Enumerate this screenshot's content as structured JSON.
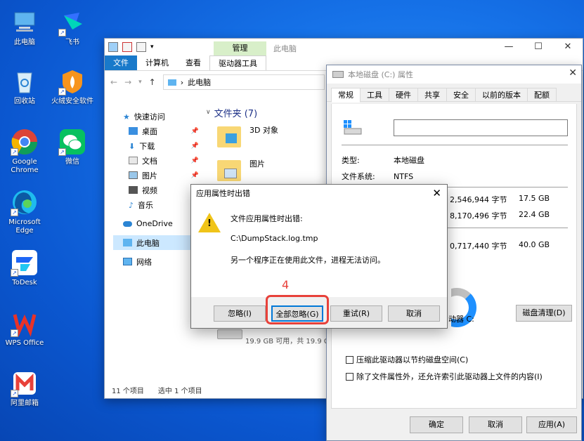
{
  "desktop": {
    "icons": [
      {
        "label": "此电脑",
        "icon": "this-pc-icon"
      },
      {
        "label": "飞书",
        "icon": "feishu-icon"
      },
      {
        "label": "回收站",
        "icon": "recycle-bin-icon"
      },
      {
        "label": "火绒安全软件",
        "icon": "huorong-icon"
      },
      {
        "label": "Google Chrome",
        "icon": "chrome-icon"
      },
      {
        "label": "微信",
        "icon": "wechat-icon"
      },
      {
        "label": "Microsoft Edge",
        "icon": "edge-icon"
      },
      {
        "label": "ToDesk",
        "icon": "todesk-icon"
      },
      {
        "label": "WPS Office",
        "icon": "wps-icon"
      },
      {
        "label": "阿里邮箱",
        "icon": "ali-mail-icon"
      }
    ]
  },
  "explorer": {
    "title_tab": "管理",
    "title": "此电脑",
    "ribbon_tabs": [
      "文件",
      "计算机",
      "查看",
      "驱动器工具"
    ],
    "address": "此电脑",
    "nav": [
      {
        "label": "快速访问"
      },
      {
        "label": "桌面"
      },
      {
        "label": "下载"
      },
      {
        "label": "文档"
      },
      {
        "label": "图片"
      },
      {
        "label": "视频"
      },
      {
        "label": "音乐"
      },
      {
        "label": "OneDrive"
      },
      {
        "label": "此电脑"
      },
      {
        "label": "网络"
      }
    ],
    "folders_header": "文件夹 (7)",
    "folders": [
      "3D 对象",
      "图片"
    ],
    "disk_sub": "19.9 GB 可用，共 19.9 G",
    "status_items": "11 个项目",
    "status_selected": "选中 1 个项目"
  },
  "properties": {
    "title": "本地磁盘 (C:) 属性",
    "tabs": [
      "常规",
      "工具",
      "硬件",
      "共享",
      "安全",
      "以前的版本",
      "配额"
    ],
    "type_label": "类型:",
    "type_value": "本地磁盘",
    "fs_label": "文件系统:",
    "fs_value": "NTFS",
    "used_bytes": "2,546,944 字节",
    "used_gb": "17.5 GB",
    "free_bytes": "8,170,496 字节",
    "free_gb": "22.4 GB",
    "total_bytes": "0,717,440 字节",
    "total_gb": "40.0 GB",
    "drive_label": "动器 C:",
    "cleanup_button": "磁盘清理(D)",
    "compress_label": "压缩此驱动器以节约磁盘空间(C)",
    "index_label": "除了文件属性外，还允许索引此驱动器上文件的内容(I)",
    "ok": "确定",
    "cancel": "取消",
    "apply": "应用(A)"
  },
  "dialog": {
    "title": "应用属性时出错",
    "line1": "文件应用属性时出错:",
    "line2": "C:\\DumpStack.log.tmp",
    "line3": "另一个程序正在使用此文件，进程无法访问。",
    "buttons": [
      "忽略(I)",
      "全部忽略(G)",
      "重试(R)",
      "取消"
    ]
  },
  "annotation": {
    "step": "4",
    "color": "#e8413a"
  }
}
